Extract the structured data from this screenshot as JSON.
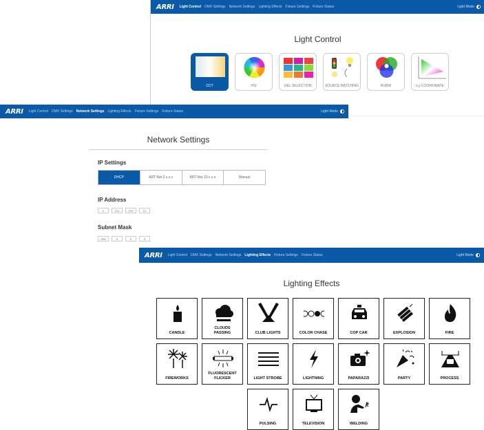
{
  "brand": "ARRI",
  "nav": [
    "Light Control",
    "DMX Settings",
    "Network Settings",
    "Lighting Effects",
    "Fixture Settings",
    "Fixture Status"
  ],
  "light_mode_label": "Light Mode",
  "light_control": {
    "title": "Light Control",
    "modes": [
      "CCT",
      "HSI",
      "GEL SELECTION",
      "SOURCE MATCHING",
      "RGBW",
      "x,y COORDINATE"
    ]
  },
  "network_settings": {
    "title": "Network Settings",
    "ip_settings_label": "IP Settings",
    "ip_options": [
      "DHCP",
      "ART-Net 2.x.x.x",
      "ART-Net 10.x.x.x",
      "Manual"
    ],
    "ip_address_label": "IP Address",
    "ip_address": [
      "2",
      "111",
      "122",
      "11"
    ],
    "subnet_mask_label": "Subnet Mask",
    "subnet_mask": [
      "255",
      "0",
      "0",
      "0"
    ]
  },
  "lighting_effects": {
    "title": "Lighting Effects",
    "effects": [
      "CANDLE",
      "CLOUDS\nPASSING",
      "CLUB LIGHTS",
      "COLOR CHASE",
      "COP CAR",
      "EXPLOSION",
      "FIRE",
      "FIREWORKS",
      "FLUORESCENT\nFLICKER",
      "LIGHT STROBE",
      "LIGHTNING",
      "PAPARAZZI",
      "PARTY",
      "PROCESS",
      "PULSING",
      "TELEVISION",
      "WELDING"
    ]
  },
  "colors": {
    "accent": "#0a5aa8"
  }
}
